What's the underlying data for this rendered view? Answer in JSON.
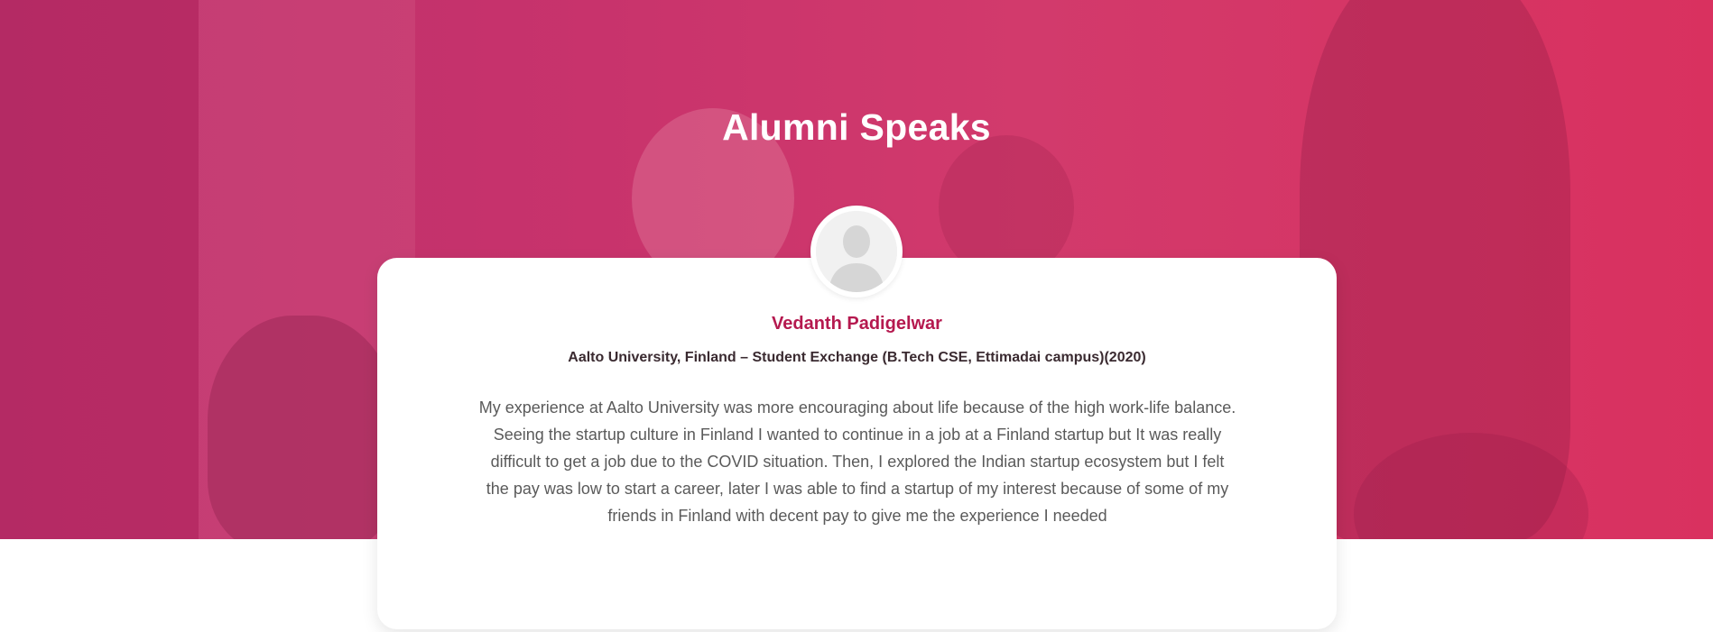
{
  "section": {
    "title": "Alumni Speaks"
  },
  "testimonial": {
    "name": "Vedanth Padigelwar",
    "affiliation": "Aalto University, Finland – Student Exchange (B.Tech CSE, Ettimadai campus)(2020)",
    "text": "My experience at Aalto University was more encouraging about life because of the high work-life balance. Seeing the startup culture in Finland I wanted to continue in a job at a Finland startup but It was really difficult to get a job due to the COVID situation. Then, I explored the Indian startup ecosystem but I felt the pay was low to start a career, later I was able to find a startup of my interest because of some of my friends in Finland with decent pay to give me the experience I needed",
    "avatar_icon": "default-user-avatar-icon"
  },
  "colors": {
    "accent": "#b5194f",
    "hero_overlay": "#d23a6c",
    "card_background": "#ffffff"
  }
}
